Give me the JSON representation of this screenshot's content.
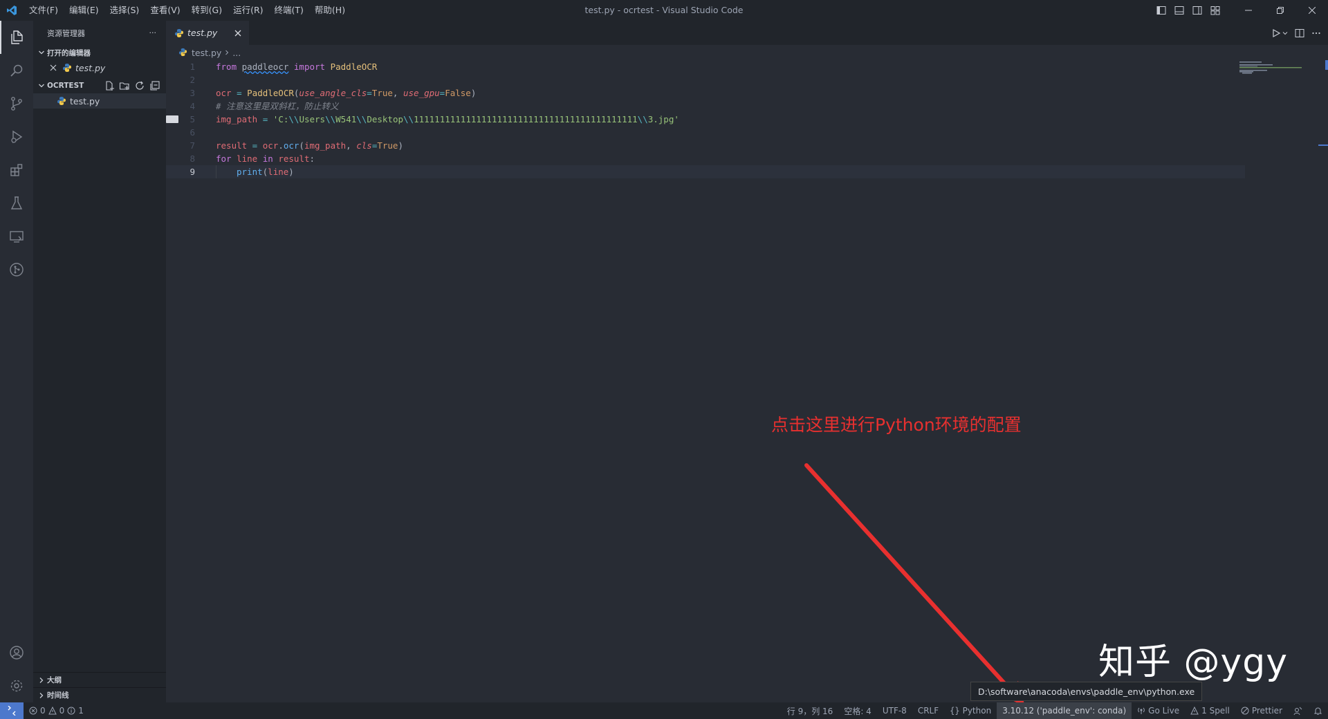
{
  "titlebar": {
    "title": "test.py - ocrtest - Visual Studio Code",
    "menu": [
      "文件(F)",
      "编辑(E)",
      "选择(S)",
      "查看(V)",
      "转到(G)",
      "运行(R)",
      "终端(T)",
      "帮助(H)"
    ]
  },
  "activitybar": {
    "items": [
      "explorer-icon",
      "search-icon",
      "source-control-icon",
      "run-debug-icon",
      "extensions-icon",
      "testing-icon",
      "remote-explorer-icon",
      "git-graph-icon"
    ],
    "bottom": [
      "account-icon",
      "settings-gear-icon"
    ]
  },
  "sidebar": {
    "header": "资源管理器",
    "more": "···",
    "open_editors_label": "打开的编辑器",
    "open_editor_file": "test.py",
    "folder_label": "OCRTEST",
    "folder_file": "test.py",
    "outline_label": "大纲",
    "timeline_label": "时间线"
  },
  "editor": {
    "tab_label": "test.py",
    "breadcrumb_file": "test.py",
    "breadcrumb_more": "...",
    "lines": [
      {
        "n": "1"
      },
      {
        "n": "2"
      },
      {
        "n": "3"
      },
      {
        "n": "4"
      },
      {
        "n": "5"
      },
      {
        "n": "6"
      },
      {
        "n": "7"
      },
      {
        "n": "8"
      },
      {
        "n": "9"
      }
    ],
    "code": {
      "l1_from": "from",
      "l1_mod": "paddleocr",
      "l1_import": "import",
      "l1_cls": "PaddleOCR",
      "l3_var": "ocr",
      "l3_eq": " = ",
      "l3_cls": "PaddleOCR",
      "l3_p1": "use_angle_cls",
      "l3_v1": "True",
      "l3_p2": "use_gpu",
      "l3_v2": "False",
      "l4_comment": "# 注意这里是双斜杠，防止转义",
      "l5_var": "img_path",
      "l5_eq": " = ",
      "l5_s1": "'C:",
      "l5_e1": "\\\\",
      "l5_s2": "Users",
      "l5_e2": "\\\\",
      "l5_s3": "W541",
      "l5_e3": "\\\\",
      "l5_s4": "Desktop",
      "l5_e4": "\\\\",
      "l5_s5": "1111111111111111111111111111111111111111111",
      "l5_e5": "\\\\",
      "l5_s6": "3.jpg'",
      "l7_var": "result",
      "l7_eq": " = ",
      "l7_obj": "ocr",
      "l7_fn": "ocr",
      "l7_arg": "img_path",
      "l7_p": "cls",
      "l7_v": "True",
      "l8_for": "for",
      "l8_var": "line",
      "l8_in": "in",
      "l8_iter": "result",
      "l9_fn": "print",
      "l9_arg": "line"
    }
  },
  "annotation": {
    "text": "点击这里进行Python环境的配置",
    "watermark": "知乎 @ygy",
    "tooltip": "D:\\software\\anacoda\\envs\\paddle_env\\python.exe"
  },
  "statusbar": {
    "errors": "0",
    "warnings": "0",
    "info": "1",
    "position": "行 9，列 16",
    "spaces": "空格: 4",
    "encoding": "UTF-8",
    "eol": "CRLF",
    "language": "Python",
    "interpreter": "3.10.12 ('paddle_env': conda)",
    "golive": "Go Live",
    "spell": "1 Spell",
    "prettier": "Prettier"
  },
  "colors": {
    "accent": "#4d78cc",
    "annotation_red": "#e8302f",
    "editor_bg": "#282c34",
    "sidebar_bg": "#21252b"
  }
}
